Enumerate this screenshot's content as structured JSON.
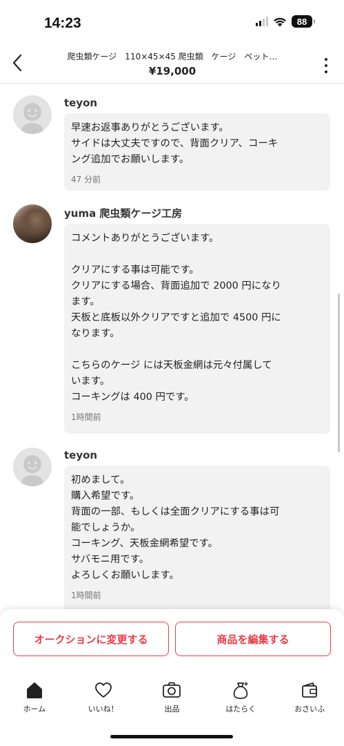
{
  "status_bar": {
    "time": "14:23",
    "battery": "88"
  },
  "header": {
    "title": "爬虫類ケージ　110×45×45 爬虫類　ケージ　ペット…",
    "price": "¥19,000",
    "back_icon": "chevron-left-icon",
    "more_icon": "vertical-ellipsis-icon"
  },
  "comments": [
    {
      "name": "teyon",
      "avatar": "default-avatar",
      "lines": [
        "早速お返事ありがとうございます。",
        "サイドは大丈夫ですので、背面クリア、コーキ",
        "ング追加でお願いします。"
      ],
      "time": "47 分前"
    },
    {
      "name": "yuma 爬虫類ケージ工房",
      "avatar": "photo-avatar",
      "lines": [
        "コメントありがとうございます。",
        "",
        "クリアにする事は可能です。",
        "クリアにする場合、背面追加で 2000 円になり",
        "ます。",
        "天板と底板以外クリアですと追加で 4500 円に",
        "なります。",
        "",
        "こちらのケージ には天板金網は元々付属して",
        "います。",
        "コーキングは 400 円です。"
      ],
      "time": "1時間前"
    },
    {
      "name": "teyon",
      "avatar": "default-avatar",
      "lines": [
        "初めまして。",
        "購入希望です。",
        "背面の一部、もしくは全面クリアにする事は可",
        "能でしょうか。",
        "コーキング、天板金網希望です。",
        "サバモニ用です。",
        "よろしくお願いします。"
      ],
      "time": "1時間前"
    }
  ],
  "actions": {
    "auction_label": "オークションに変更する",
    "edit_label": "商品を編集する",
    "accent_color": "#ea3b48"
  },
  "tabs": [
    {
      "label": "ホーム",
      "icon": "home-icon"
    },
    {
      "label": "いいね！",
      "icon": "heart-icon"
    },
    {
      "label": "出品",
      "icon": "camera-icon"
    },
    {
      "label": "はたらく",
      "icon": "money-bag-icon"
    },
    {
      "label": "おさいふ",
      "icon": "wallet-icon"
    }
  ]
}
